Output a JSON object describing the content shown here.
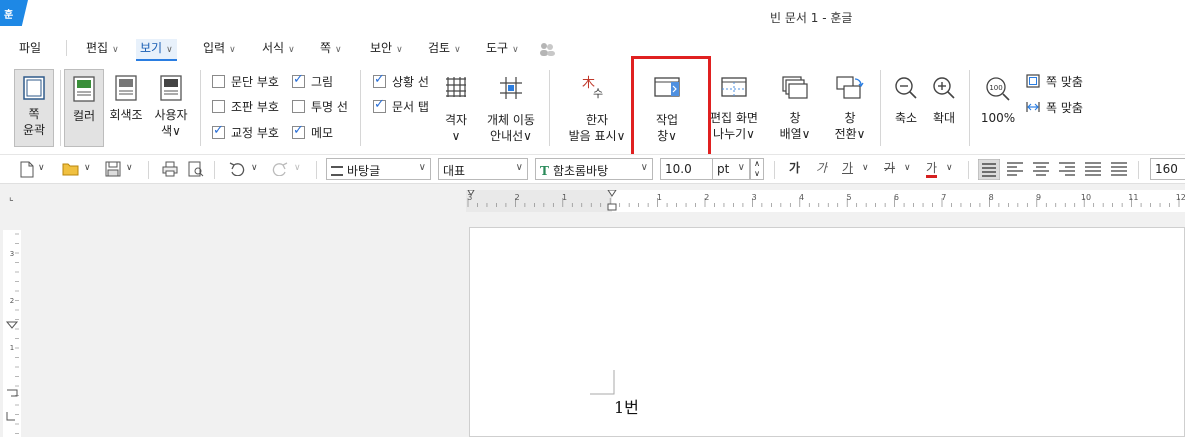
{
  "app": {
    "logo_text": "훈",
    "window_title": "빈 문서 1 - 훈글"
  },
  "menu": {
    "items": [
      {
        "label": "파일",
        "chevron": false
      },
      {
        "label": "편집",
        "chevron": true
      },
      {
        "label": "보기",
        "chevron": true,
        "active": true
      },
      {
        "label": "입력",
        "chevron": true
      },
      {
        "label": "서식",
        "chevron": true
      },
      {
        "label": "쪽",
        "chevron": true
      },
      {
        "label": "보안",
        "chevron": true
      },
      {
        "label": "검토",
        "chevron": true
      },
      {
        "label": "도구",
        "chevron": true
      }
    ],
    "chevron": "∨"
  },
  "ribbon": {
    "page_outline": {
      "line1": "쪽",
      "line2": "윤곽"
    },
    "color": {
      "label": "컬러"
    },
    "grayscale": {
      "label": "회색조"
    },
    "custom": {
      "line1": "사용자",
      "line2": "색∨"
    },
    "checks": [
      {
        "label": "문단 부호",
        "checked": false
      },
      {
        "label": "조판 부호",
        "checked": false
      },
      {
        "label": "교정 부호",
        "checked": true
      },
      {
        "label": "그림",
        "checked": true
      },
      {
        "label": "투명 선",
        "checked": false
      },
      {
        "label": "메모",
        "checked": true
      },
      {
        "label": "상황 선",
        "checked": true
      },
      {
        "label": "문서 탭",
        "checked": true
      }
    ],
    "grid": {
      "line1": "격자",
      "line2": "∨"
    },
    "object_move": {
      "line1": "개체 이동",
      "line2": "안내선∨"
    },
    "hanja": {
      "line1": "한자",
      "line2": "발음 표시∨",
      "glyph1": "木",
      "glyph2": "수"
    },
    "task_pane": {
      "line1": "작업",
      "line2": "창∨"
    },
    "split_view": {
      "line1": "편집 화면",
      "line2": "나누기∨"
    },
    "arrange": {
      "line1": "창",
      "line2": "배열∨"
    },
    "switch": {
      "line1": "창",
      "line2": "전환∨"
    },
    "zoom_out": {
      "label": "축소"
    },
    "zoom_in": {
      "label": "확대"
    },
    "zoom_100": {
      "label": "100%",
      "icon_text": "100"
    },
    "fit_page": {
      "label": "쪽 맞춤"
    },
    "fit_width": {
      "label": "폭 맞춤"
    }
  },
  "toolbar": {
    "style": "바탕글",
    "style_alt": "대표",
    "font": "함초롬바탕",
    "font_icon": "T",
    "size": "10.0",
    "unit": "pt",
    "bold": "가",
    "italic": "가",
    "underline": "가",
    "strike": "가",
    "color_text": "가",
    "zoom_value": "160",
    "dd_chevron": "∨"
  },
  "ruler": {
    "h_numbers": [
      "3",
      "2",
      "1",
      "1",
      "2",
      "3",
      "4",
      "5",
      "6",
      "7",
      "8",
      "9",
      "10",
      "11",
      "12"
    ],
    "v_numbers": [
      "3",
      "2",
      "1"
    ]
  },
  "document": {
    "text": "1번"
  }
}
